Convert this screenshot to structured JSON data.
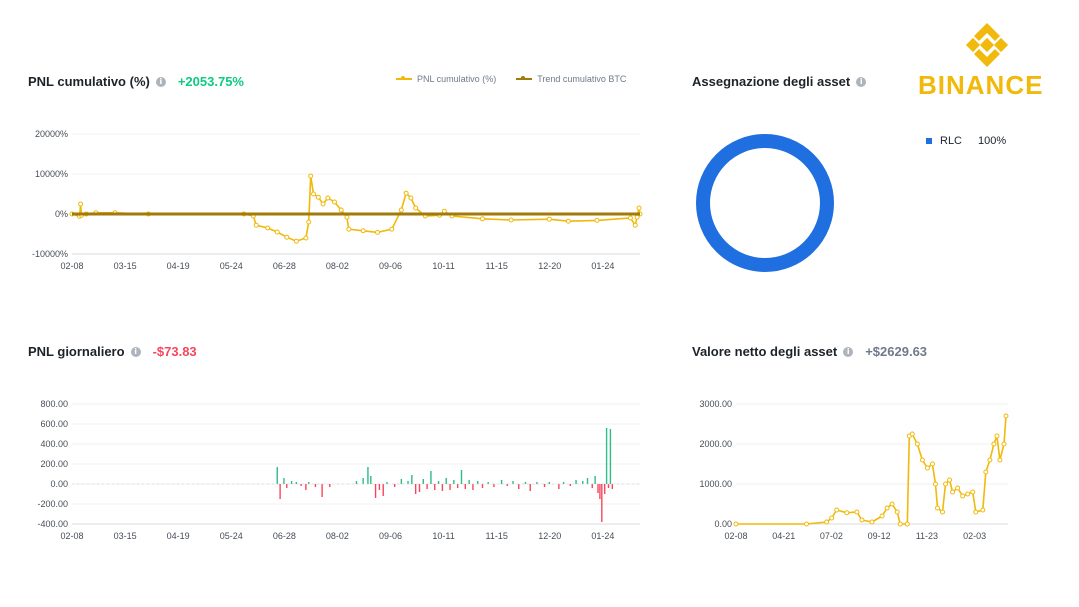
{
  "brand": {
    "name": "BINANCE",
    "color": "#f0b90b"
  },
  "cumulative": {
    "title": "PNL cumulativo (%)",
    "value": "+2053.75%",
    "legend": [
      "PNL cumulativo (%)",
      "Trend cumulativo BTC"
    ]
  },
  "allocation": {
    "title": "Assegnazione degli asset",
    "asset": "RLC",
    "percent": "100%"
  },
  "daily": {
    "title": "PNL giornaliero",
    "value": "-$73.83"
  },
  "networth": {
    "title": "Valore netto degli asset",
    "value": "+$2629.63"
  },
  "chart_data": [
    {
      "type": "line",
      "x_ticks": [
        "02-08",
        "03-15",
        "04-19",
        "05-24",
        "06-28",
        "08-02",
        "09-06",
        "10-11",
        "11-15",
        "12-20",
        "01-24"
      ],
      "y_ticks": [
        "20000%",
        "10000%",
        "0%",
        "-10000%"
      ],
      "ylim": [
        -10000,
        20000
      ],
      "series": [
        {
          "name": "PNL cumulativo (%)",
          "color": "#f0b90b",
          "points": [
            [
              0,
              0
            ],
            [
              8,
              -600
            ],
            [
              9,
              2500
            ],
            [
              10,
              -300
            ],
            [
              15,
              0
            ],
            [
              25,
              300
            ],
            [
              45,
              300
            ],
            [
              80,
              0
            ],
            [
              180,
              0
            ],
            [
              190,
              -500
            ],
            [
              193,
              -2800
            ],
            [
              205,
              -3500
            ],
            [
              215,
              -4500
            ],
            [
              225,
              -5800
            ],
            [
              235,
              -6800
            ],
            [
              245,
              -6000
            ],
            [
              248,
              -2000
            ],
            [
              250,
              9500
            ],
            [
              253,
              5000
            ],
            [
              258,
              4200
            ],
            [
              263,
              2500
            ],
            [
              268,
              4000
            ],
            [
              275,
              3000
            ],
            [
              282,
              1000
            ],
            [
              288,
              -800
            ],
            [
              290,
              -3800
            ],
            [
              305,
              -4200
            ],
            [
              320,
              -4600
            ],
            [
              335,
              -3800
            ],
            [
              345,
              1000
            ],
            [
              350,
              5200
            ],
            [
              355,
              4000
            ],
            [
              360,
              1500
            ],
            [
              370,
              -500
            ],
            [
              385,
              -300
            ],
            [
              390,
              700
            ],
            [
              398,
              -500
            ],
            [
              430,
              -1200
            ],
            [
              460,
              -1500
            ],
            [
              500,
              -1300
            ],
            [
              520,
              -1800
            ],
            [
              550,
              -1600
            ],
            [
              585,
              -1000
            ],
            [
              590,
              -2800
            ],
            [
              592,
              -800
            ],
            [
              594,
              1500
            ],
            [
              595,
              0
            ]
          ]
        },
        {
          "name": "Trend cumulativo BTC",
          "color": "#a07a0a",
          "points": [
            [
              0,
              0
            ],
            [
              595,
              0
            ]
          ]
        }
      ]
    },
    {
      "type": "pie",
      "labels": [
        "RLC"
      ],
      "values": [
        100
      ],
      "colors": [
        "#1f6fe0"
      ]
    },
    {
      "type": "bar",
      "x_ticks": [
        "02-08",
        "03-15",
        "04-19",
        "05-24",
        "06-28",
        "08-02",
        "09-06",
        "10-11",
        "11-15",
        "12-20",
        "01-24"
      ],
      "y_ticks": [
        "800.00",
        "600.00",
        "400.00",
        "200.00",
        "0.00",
        "-200.00",
        "-400.00"
      ],
      "ylim": [
        -400,
        800
      ],
      "bars": [
        [
          215,
          170
        ],
        [
          218,
          -150
        ],
        [
          222,
          60
        ],
        [
          225,
          -40
        ],
        [
          230,
          30
        ],
        [
          235,
          20
        ],
        [
          240,
          -20
        ],
        [
          245,
          -60
        ],
        [
          248,
          20
        ],
        [
          255,
          -30
        ],
        [
          262,
          -130
        ],
        [
          270,
          -30
        ],
        [
          298,
          30
        ],
        [
          305,
          60
        ],
        [
          310,
          170
        ],
        [
          313,
          80
        ],
        [
          318,
          -140
        ],
        [
          322,
          -60
        ],
        [
          326,
          -120
        ],
        [
          330,
          20
        ],
        [
          338,
          -30
        ],
        [
          345,
          50
        ],
        [
          352,
          30
        ],
        [
          356,
          90
        ],
        [
          360,
          -100
        ],
        [
          364,
          -80
        ],
        [
          368,
          50
        ],
        [
          372,
          -50
        ],
        [
          376,
          130
        ],
        [
          380,
          -60
        ],
        [
          384,
          30
        ],
        [
          388,
          -70
        ],
        [
          392,
          60
        ],
        [
          396,
          -60
        ],
        [
          400,
          40
        ],
        [
          404,
          -40
        ],
        [
          408,
          140
        ],
        [
          412,
          -50
        ],
        [
          416,
          40
        ],
        [
          420,
          -60
        ],
        [
          425,
          30
        ],
        [
          430,
          -40
        ],
        [
          436,
          20
        ],
        [
          442,
          -30
        ],
        [
          450,
          40
        ],
        [
          456,
          -20
        ],
        [
          462,
          30
        ],
        [
          468,
          -50
        ],
        [
          475,
          20
        ],
        [
          480,
          -70
        ],
        [
          487,
          20
        ],
        [
          495,
          -30
        ],
        [
          500,
          20
        ],
        [
          510,
          -50
        ],
        [
          515,
          20
        ],
        [
          522,
          -20
        ],
        [
          528,
          40
        ],
        [
          535,
          30
        ],
        [
          540,
          60
        ],
        [
          545,
          -40
        ],
        [
          548,
          80
        ],
        [
          551,
          -90
        ],
        [
          553,
          -150
        ],
        [
          555,
          -380
        ],
        [
          558,
          -100
        ],
        [
          560,
          560
        ],
        [
          562,
          -40
        ],
        [
          564,
          550
        ],
        [
          566,
          -50
        ]
      ]
    },
    {
      "type": "line",
      "x_ticks": [
        "02-08",
        "04-21",
        "07-02",
        "09-12",
        "11-23",
        "02-03"
      ],
      "y_ticks": [
        "3000.00",
        "2000.00",
        "1000.00",
        "0.00"
      ],
      "ylim": [
        0,
        3000
      ],
      "series": [
        {
          "name": "",
          "color": "#f0b90b",
          "points": [
            [
              0,
              0
            ],
            [
              70,
              0
            ],
            [
              90,
              50
            ],
            [
              95,
              150
            ],
            [
              100,
              350
            ],
            [
              110,
              280
            ],
            [
              120,
              300
            ],
            [
              125,
              100
            ],
            [
              135,
              50
            ],
            [
              145,
              200
            ],
            [
              150,
              400
            ],
            [
              155,
              500
            ],
            [
              160,
              300
            ],
            [
              163,
              0
            ],
            [
              170,
              0
            ],
            [
              172,
              2200
            ],
            [
              175,
              2250
            ],
            [
              180,
              2000
            ],
            [
              185,
              1600
            ],
            [
              190,
              1400
            ],
            [
              195,
              1500
            ],
            [
              198,
              1000
            ],
            [
              200,
              400
            ],
            [
              205,
              300
            ],
            [
              208,
              1000
            ],
            [
              212,
              1100
            ],
            [
              215,
              800
            ],
            [
              220,
              900
            ],
            [
              225,
              700
            ],
            [
              230,
              750
            ],
            [
              235,
              800
            ],
            [
              238,
              300
            ],
            [
              245,
              350
            ],
            [
              248,
              1300
            ],
            [
              252,
              1600
            ],
            [
              256,
              2000
            ],
            [
              259,
              2200
            ],
            [
              262,
              1600
            ],
            [
              266,
              2000
            ],
            [
              268,
              2700
            ]
          ]
        }
      ]
    }
  ]
}
